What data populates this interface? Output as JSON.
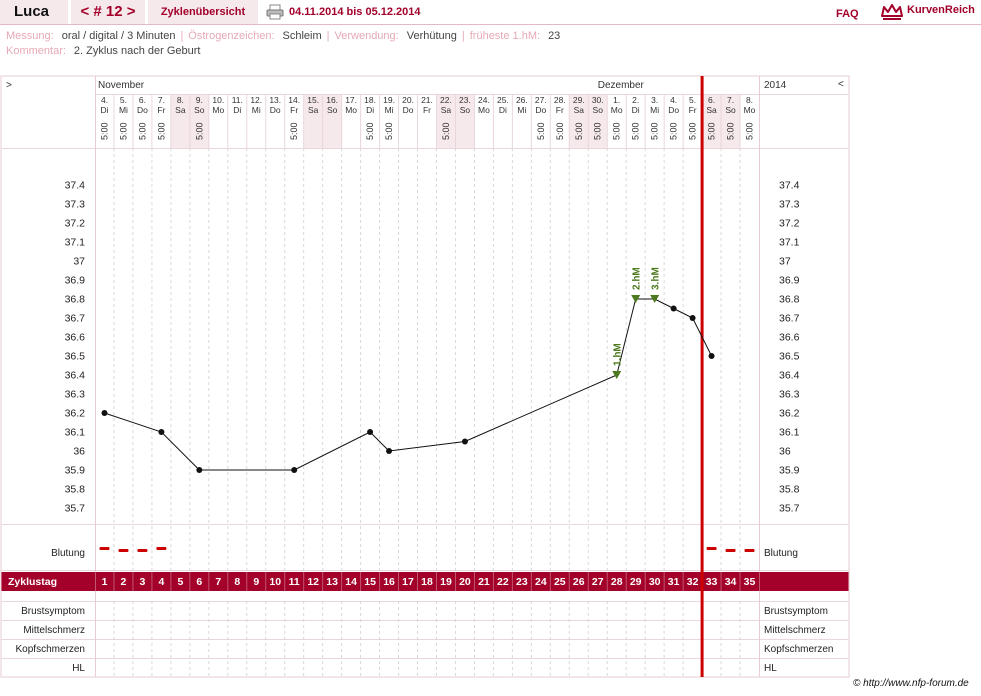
{
  "header": {
    "name": "Luca",
    "nav": {
      "prev": "<",
      "cycle": "# 12",
      "next": ">"
    },
    "cycle_overview_label": "Zyklenübersicht",
    "date_range": "04.11.2014 bis 05.12.2014",
    "faq_label": "FAQ",
    "logo_text": "KurvenReich"
  },
  "meta": {
    "messung_label": "Messung:",
    "messung_value": "oral / digital / 3 Minuten",
    "oestrogen_label": "Östrogenzeichen:",
    "oestrogen_value": "Schleim",
    "verwendung_label": "Verwendung:",
    "verwendung_value": "Verhütung",
    "frueheste_label": "früheste 1.hM:",
    "frueheste_value": "23",
    "kommentar_label": "Kommentar:",
    "kommentar_value": "2. Zyklus nach der Geburt"
  },
  "chart": {
    "left_arrow": ">",
    "right_arrow": "<",
    "month_1": "November",
    "month_2": "Dezember",
    "year": "2014",
    "y_ticks": [
      "37.4",
      "37.3",
      "37.2",
      "37.1",
      "37",
      "36.9",
      "36.8",
      "36.7",
      "36.6",
      "36.5",
      "36.4",
      "36.3",
      "36.2",
      "36.1",
      "36",
      "35.9",
      "35.8",
      "35.7"
    ],
    "days": [
      {
        "d": "4.",
        "w": "Di",
        "t": "5:00",
        "we": false
      },
      {
        "d": "5.",
        "w": "Mi",
        "t": "5:00",
        "we": false
      },
      {
        "d": "6.",
        "w": "Do",
        "t": "5:00",
        "we": false
      },
      {
        "d": "7.",
        "w": "Fr",
        "t": "5:00",
        "we": false
      },
      {
        "d": "8.",
        "w": "Sa",
        "t": "",
        "we": true
      },
      {
        "d": "9.",
        "w": "So",
        "t": "5:00",
        "we": true
      },
      {
        "d": "10.",
        "w": "Mo",
        "t": "",
        "we": false
      },
      {
        "d": "11.",
        "w": "Di",
        "t": "",
        "we": false
      },
      {
        "d": "12.",
        "w": "Mi",
        "t": "",
        "we": false
      },
      {
        "d": "13.",
        "w": "Do",
        "t": "",
        "we": false
      },
      {
        "d": "14.",
        "w": "Fr",
        "t": "5:00",
        "we": false
      },
      {
        "d": "15.",
        "w": "Sa",
        "t": "",
        "we": true
      },
      {
        "d": "16.",
        "w": "So",
        "t": "",
        "we": true
      },
      {
        "d": "17.",
        "w": "Mo",
        "t": "",
        "we": false
      },
      {
        "d": "18.",
        "w": "Di",
        "t": "5:00",
        "we": false
      },
      {
        "d": "19.",
        "w": "Mi",
        "t": "5:00",
        "we": false
      },
      {
        "d": "20.",
        "w": "Do",
        "t": "",
        "we": false
      },
      {
        "d": "21.",
        "w": "Fr",
        "t": "",
        "we": false
      },
      {
        "d": "22.",
        "w": "Sa",
        "t": "5:00",
        "we": true
      },
      {
        "d": "23.",
        "w": "So",
        "t": "",
        "we": true
      },
      {
        "d": "24.",
        "w": "Mo",
        "t": "",
        "we": false
      },
      {
        "d": "25.",
        "w": "Di",
        "t": "",
        "we": false
      },
      {
        "d": "26.",
        "w": "Mi",
        "t": "",
        "we": false
      },
      {
        "d": "27.",
        "w": "Do",
        "t": "5:00",
        "we": false
      },
      {
        "d": "28.",
        "w": "Fr",
        "t": "5:00",
        "we": false
      },
      {
        "d": "29.",
        "w": "Sa",
        "t": "5:00",
        "we": true
      },
      {
        "d": "30.",
        "w": "So",
        "t": "5:00",
        "we": true
      },
      {
        "d": "1.",
        "w": "Mo",
        "t": "5:00",
        "we": false
      },
      {
        "d": "2.",
        "w": "Di",
        "t": "5:00",
        "we": false
      },
      {
        "d": "3.",
        "w": "Mi",
        "t": "5:00",
        "we": false
      },
      {
        "d": "4.",
        "w": "Do",
        "t": "5:00",
        "we": false
      },
      {
        "d": "5.",
        "w": "Fr",
        "t": "5:00",
        "we": false
      },
      {
        "d": "6.",
        "w": "Sa",
        "t": "5:00",
        "we": true
      },
      {
        "d": "7.",
        "w": "So",
        "t": "5:00",
        "we": true
      },
      {
        "d": "8.",
        "w": "Mo",
        "t": "5:00",
        "we": false
      }
    ],
    "cycle_days": [
      "1",
      "2",
      "3",
      "4",
      "5",
      "6",
      "7",
      "8",
      "9",
      "10",
      "11",
      "12",
      "13",
      "14",
      "15",
      "16",
      "17",
      "18",
      "19",
      "20",
      "21",
      "22",
      "23",
      "24",
      "25",
      "26",
      "27",
      "28",
      "29",
      "30",
      "31",
      "32",
      "33",
      "34",
      "35"
    ],
    "labels": {
      "blutung": "Blutung",
      "zyklustag": "Zyklustag",
      "brustsymptom": "Brustsymptom",
      "mittelschmerz": "Mittelschmerz",
      "kopfschmerzen": "Kopfschmerzen",
      "hl": "HL"
    },
    "colors": {
      "accent": "#a3002a",
      "marker_red": "#cc0000",
      "marker_green": "#4d7a1f",
      "weekend": "#f6e9ec"
    }
  },
  "chart_data": {
    "type": "line",
    "x": [
      1,
      4,
      6,
      11,
      15,
      16,
      20,
      28,
      29,
      30,
      31,
      32,
      33
    ],
    "y": [
      36.2,
      36.1,
      35.9,
      35.9,
      36.1,
      36.0,
      36.05,
      36.4,
      36.8,
      36.8,
      36.75,
      36.7,
      36.5
    ],
    "ylim": [
      35.7,
      37.4
    ],
    "xlim": [
      1,
      35
    ],
    "bleeding_days": [
      1,
      2,
      3,
      4,
      33,
      34,
      35
    ],
    "annotations": [
      {
        "day": 28,
        "label": "1.hM"
      },
      {
        "day": 29,
        "label": "2.hM"
      },
      {
        "day": 30,
        "label": "3.hM"
      }
    ],
    "marker_day": 33
  },
  "footer": {
    "credit": "© http://www.nfp-forum.de"
  }
}
